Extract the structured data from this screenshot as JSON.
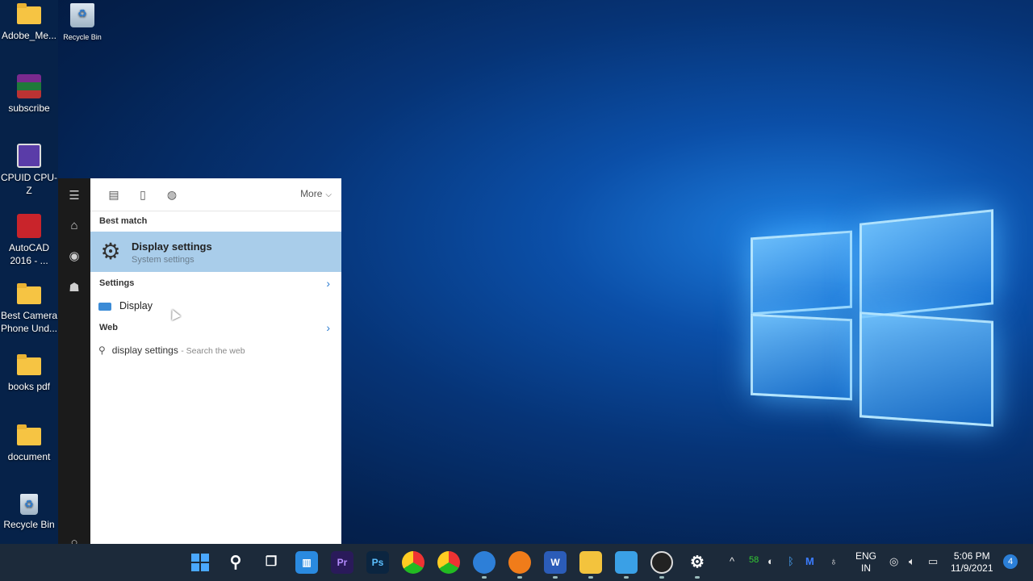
{
  "desktop": {
    "icons": [
      {
        "label": "Adobe_Me...",
        "icon": "folder-icon"
      },
      {
        "label": "subscribe",
        "icon": "winrar-archive-icon"
      },
      {
        "label": "CPUID CPU-Z",
        "icon": "cpu-z-icon"
      },
      {
        "label": "AutoCAD 2016 - ...",
        "icon": "autocad-icon"
      },
      {
        "label": "Best Camera Phone Und...",
        "icon": "folder-icon"
      },
      {
        "label": "books pdf",
        "icon": "folder-icon"
      },
      {
        "label": "document",
        "icon": "folder-icon"
      },
      {
        "label": "Recycle Bin",
        "icon": "recycle-bin-icon"
      }
    ],
    "top_recycle_label": "Recycle Bin"
  },
  "search_panel": {
    "more_label": "More",
    "best_match_label": "Best match",
    "best_match": {
      "title": "Display settings",
      "subtitle": "System settings"
    },
    "settings_label": "Settings",
    "settings_items": [
      {
        "label": "Display"
      }
    ],
    "web_label": "Web",
    "web_query": "display settings",
    "web_hint": "- Search the web"
  },
  "taskbar": {
    "apps": [
      {
        "name": "start",
        "icon": "windows-start-icon"
      },
      {
        "name": "search",
        "icon": "search-icon"
      },
      {
        "name": "task-view",
        "icon": "task-view-icon"
      },
      {
        "name": "widgets",
        "icon": "widgets-icon"
      },
      {
        "name": "premiere-pro",
        "label": "Pr",
        "icon": "premiere-pro-icon"
      },
      {
        "name": "photoshop",
        "label": "Ps",
        "icon": "photoshop-icon"
      },
      {
        "name": "chrome",
        "icon": "chrome-icon"
      },
      {
        "name": "chrome-2",
        "icon": "chrome-icon"
      },
      {
        "name": "app-blue",
        "icon": "app-icon"
      },
      {
        "name": "app-orange",
        "icon": "app-icon"
      },
      {
        "name": "word",
        "label": "W",
        "icon": "word-icon"
      },
      {
        "name": "file-explorer",
        "icon": "folder-icon"
      },
      {
        "name": "notepad",
        "icon": "notepad-icon"
      },
      {
        "name": "obs",
        "icon": "obs-icon"
      },
      {
        "name": "settings",
        "icon": "gear-icon"
      }
    ],
    "tray": {
      "badge_count": "58",
      "lang_line1": "ENG",
      "lang_line2": "IN",
      "time": "5:06 PM",
      "date": "11/9/2021",
      "notification_count": "4"
    }
  }
}
